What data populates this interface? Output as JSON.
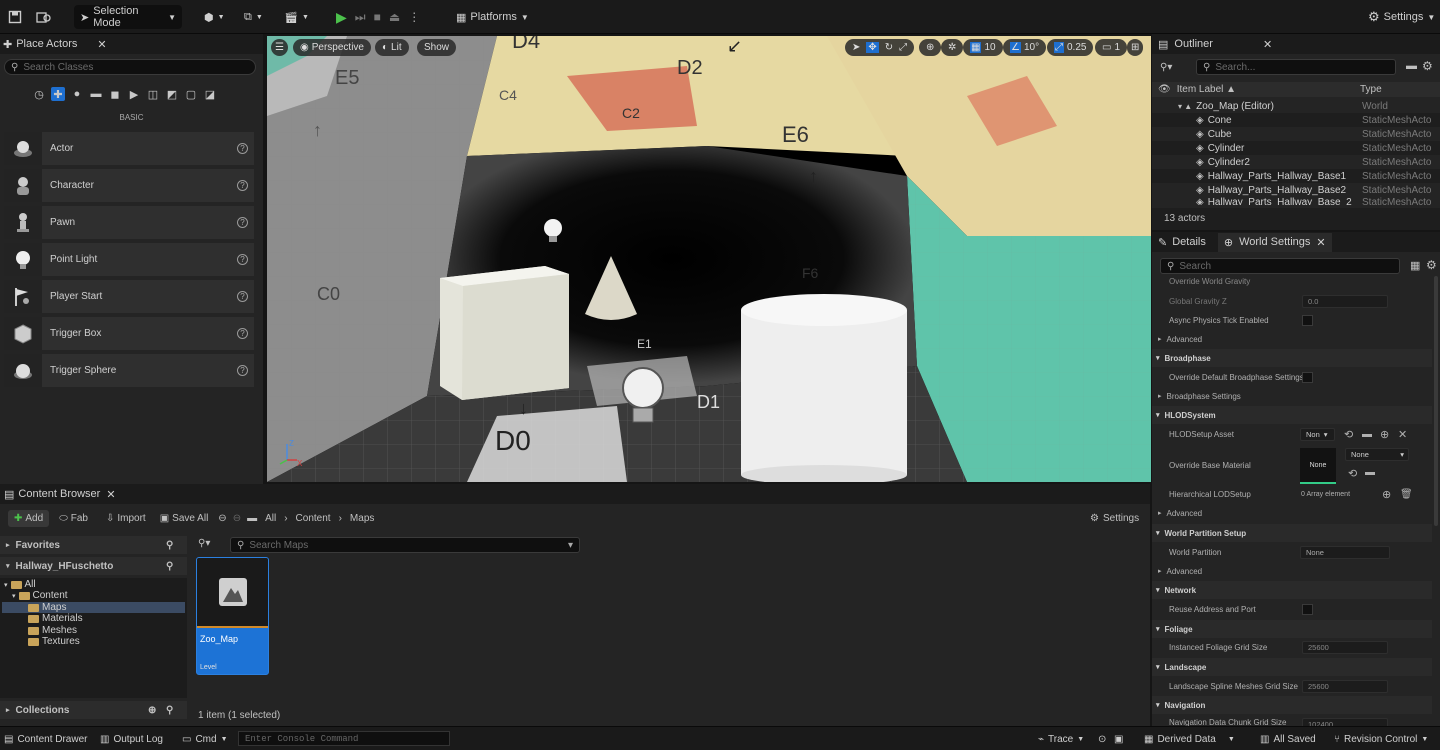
{
  "toolbar": {
    "selection_mode": "Selection Mode",
    "platforms": "Platforms",
    "settings": "Settings"
  },
  "place_actors": {
    "tab": "Place Actors",
    "search_placeholder": "Search Classes",
    "category": "BASIC",
    "items": [
      {
        "label": "Actor"
      },
      {
        "label": "Character"
      },
      {
        "label": "Pawn"
      },
      {
        "label": "Point Light"
      },
      {
        "label": "Player Start"
      },
      {
        "label": "Trigger Box"
      },
      {
        "label": "Trigger Sphere"
      }
    ]
  },
  "viewport": {
    "perspective": "Perspective",
    "lit": "Lit",
    "show": "Show",
    "grid_snap": "10",
    "rot_snap": "10°",
    "scale_snap": "0.25",
    "camera_speed": "1",
    "wall_labels": {
      "d4": "D4",
      "d2": "D2",
      "c4": "C4",
      "c2": "C2",
      "e6": "E6",
      "e5": "E5",
      "f6": "F6",
      "e1": "E1",
      "d0": "D0",
      "d1": "D1",
      "c0": "C0"
    },
    "axis": {
      "x": "X",
      "z": "Z"
    }
  },
  "outliner": {
    "tab": "Outliner",
    "search_placeholder": "Search...",
    "col_label": "Item Label ▲",
    "col_type": "Type",
    "rows": [
      {
        "label": "Zoo_Map (Editor)",
        "type": "World"
      },
      {
        "label": "Cone",
        "type": "StaticMeshActo"
      },
      {
        "label": "Cube",
        "type": "StaticMeshActo"
      },
      {
        "label": "Cylinder",
        "type": "StaticMeshActo"
      },
      {
        "label": "Cylinder2",
        "type": "StaticMeshActo"
      },
      {
        "label": "Hallway_Parts_Hallway_Base1",
        "type": "StaticMeshActo"
      },
      {
        "label": "Hallway_Parts_Hallway_Base2",
        "type": "StaticMeshActo"
      },
      {
        "label": "Hallway_Parts_Hallway_Base_2",
        "type": "StaticMeshActo"
      }
    ],
    "count": "13 actors"
  },
  "details": {
    "tab_details": "Details",
    "tab_world": "World Settings",
    "search_placeholder": "Search",
    "override_world_gravity": "Override World Gravity",
    "global_gravity": "Global Gravity Z",
    "global_gravity_val": "0.0",
    "async_physics": "Async Physics Tick Enabled",
    "advanced": "Advanced",
    "broadphase": "Broadphase",
    "override_broadphase": "Override Default Broadphase Settings",
    "broadphase_settings": "Broadphase Settings",
    "hlod": "HLODSystem",
    "hlod_setup": "HLODSetup Asset",
    "hlod_setup_val": "Non",
    "override_base_mat": "Override Base Material",
    "none": "None",
    "hier_lod": "Hierarchical LODSetup",
    "hier_lod_val": "0 Array element",
    "wp_setup": "World Partition Setup",
    "wp": "World Partition",
    "network": "Network",
    "reuse_addr": "Reuse Address and Port",
    "foliage": "Foliage",
    "foliage_grid": "Instanced Foliage Grid Size",
    "foliage_grid_val": "25600",
    "landscape": "Landscape",
    "landscape_grid": "Landscape Spline Meshes Grid Size",
    "landscape_grid_val": "25600",
    "navigation": "Navigation",
    "nav_chunk": "Navigation Data Chunk Grid Size",
    "nav_chunk_val": "102400"
  },
  "content_browser": {
    "tab": "Content Browser",
    "add": "Add",
    "fab": "Fab",
    "import": "Import",
    "save_all": "Save All",
    "path": [
      "All",
      "Content",
      "Maps"
    ],
    "settings": "Settings",
    "favorites": "Favorites",
    "project": "Hallway_HFuschetto",
    "tree": [
      "All",
      "Content",
      "Maps",
      "Materials",
      "Meshes",
      "Textures"
    ],
    "collections": "Collections",
    "search_placeholder": "Search Maps",
    "asset_name": "Zoo_Map",
    "asset_type": "Level",
    "item_count": "1 item (1 selected)"
  },
  "statusbar": {
    "content_drawer": "Content Drawer",
    "output_log": "Output Log",
    "cmd": "Cmd",
    "console_placeholder": "Enter Console Command",
    "trace": "Trace",
    "derived_data": "Derived Data",
    "all_saved": "All Saved",
    "revision_control": "Revision Control"
  }
}
